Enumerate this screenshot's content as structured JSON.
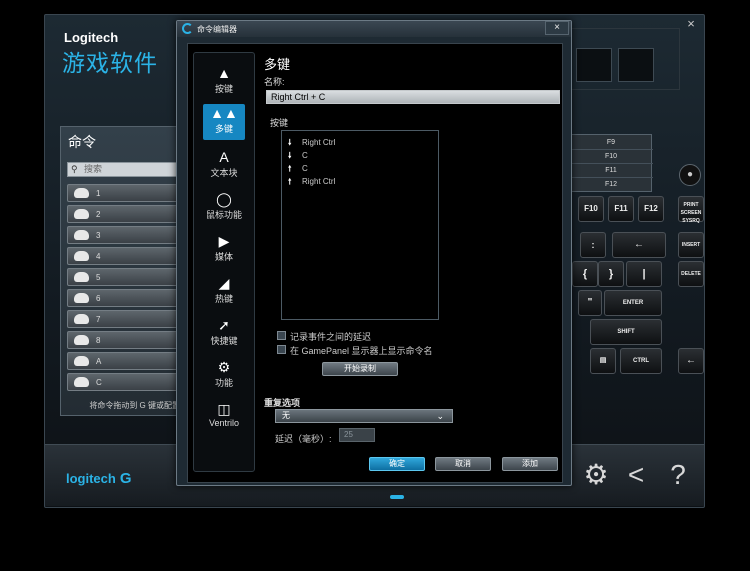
{
  "app": {
    "brand": "Logitech",
    "subtitle": "游戏软件",
    "close_glyph": "×"
  },
  "commands_panel": {
    "title": "命令",
    "search_placeholder": "搜索",
    "items": [
      {
        "label": "1"
      },
      {
        "label": "2"
      },
      {
        "label": "3"
      },
      {
        "label": "4"
      },
      {
        "label": "5"
      },
      {
        "label": "6"
      },
      {
        "label": "7"
      },
      {
        "label": "8"
      },
      {
        "label": "A"
      },
      {
        "label": "C"
      }
    ],
    "hint": "将命令拖动到 G 键或配置"
  },
  "keyboard": {
    "fkeys_overlay": [
      "F9",
      "F10",
      "F11",
      "F12"
    ],
    "keys": [
      "F10",
      "F11",
      "F12",
      "PRINT SCREEN SYSRQ",
      "INSERT",
      "DELETE",
      "ENTER",
      "SHIFT",
      "CTRL",
      "←"
    ]
  },
  "bottom": {
    "logo": "logitech",
    "logo_g": "G"
  },
  "dialog": {
    "title": "命令编辑器",
    "close_glyph": "×",
    "sidebar": [
      {
        "label": "按键",
        "icon": "key-icon"
      },
      {
        "label": "多键",
        "icon": "multikey-icon",
        "active": true
      },
      {
        "label": "文本块",
        "icon": "text-block-icon"
      },
      {
        "label": "鼠标功能",
        "icon": "mouse-icon"
      },
      {
        "label": "媒体",
        "icon": "media-play-icon"
      },
      {
        "label": "热键",
        "icon": "hotkey-icon"
      },
      {
        "label": "快捷键",
        "icon": "shortcut-arrow-icon"
      },
      {
        "label": "功能",
        "icon": "gear-icon"
      },
      {
        "label": "Ventrilo",
        "icon": "headset-icon"
      }
    ],
    "heading": "多键",
    "name_label": "名称:",
    "name_value": "Right Ctrl + C",
    "keystrokes_label": "按键",
    "keystrokes": [
      {
        "dir": "down",
        "key": "Right Ctrl"
      },
      {
        "dir": "down",
        "key": "C"
      },
      {
        "dir": "up",
        "key": "C"
      },
      {
        "dir": "up",
        "key": "Right Ctrl"
      }
    ],
    "record_delays_label": "记录事件之间的延迟",
    "show_gamepanel_label": "在 GamePanel 显示器上显示命令名",
    "start_record_label": "开始录制",
    "repeat_label": "重复选项",
    "repeat_value": "无",
    "delay_label": "延迟（毫秒）:",
    "delay_value": "25",
    "ok_label": "确定",
    "cancel_label": "取消",
    "add_label": "添加"
  }
}
